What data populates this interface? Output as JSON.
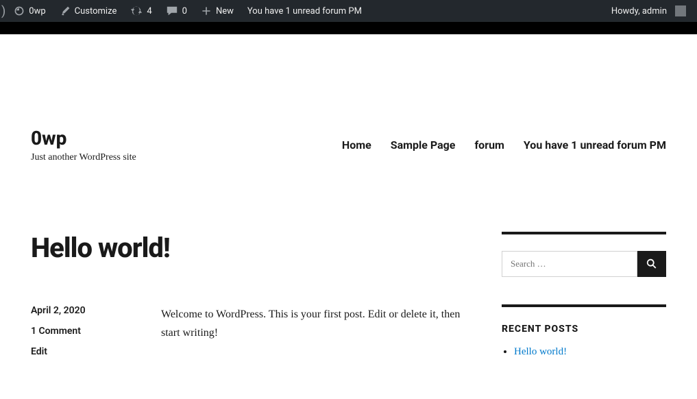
{
  "adminbar": {
    "site_name": "0wp",
    "customize": "Customize",
    "updates": "4",
    "comments": "0",
    "new": "New",
    "pm_notice": "You have 1 unread forum PM",
    "greeting": "Howdy, admin"
  },
  "site": {
    "title": "0wp",
    "tagline": "Just another WordPress site"
  },
  "nav": {
    "items": [
      {
        "label": "Home"
      },
      {
        "label": "Sample Page"
      },
      {
        "label": "forum"
      },
      {
        "label": "You have 1 unread forum PM"
      }
    ]
  },
  "post": {
    "title": "Hello world!",
    "date": "April 2, 2020",
    "comments": "1 Comment",
    "edit": "Edit",
    "body": "Welcome to WordPress. This is your first post. Edit or delete it, then start writing!"
  },
  "sidebar": {
    "search_placeholder": "Search …",
    "recent_posts_title": "RECENT POSTS",
    "recent_posts": [
      {
        "title": "Hello world!"
      }
    ]
  }
}
